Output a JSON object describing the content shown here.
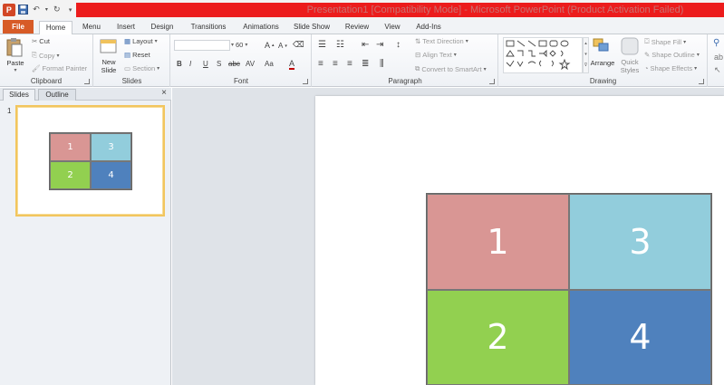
{
  "window": {
    "title": "Presentation1 [Compatibility Mode] - Microsoft PowerPoint (Product Activation Failed)"
  },
  "tabs": [
    {
      "label": "File"
    },
    {
      "label": "Home"
    },
    {
      "label": "Menu"
    },
    {
      "label": "Insert"
    },
    {
      "label": "Design"
    },
    {
      "label": "Transitions"
    },
    {
      "label": "Animations"
    },
    {
      "label": "Slide Show"
    },
    {
      "label": "Review"
    },
    {
      "label": "View"
    },
    {
      "label": "Add-Ins"
    }
  ],
  "ribbon": {
    "clipboard": {
      "label": "Clipboard",
      "paste": "Paste",
      "cut": "Cut",
      "copy": "Copy",
      "format_painter": "Format Painter"
    },
    "slides": {
      "label": "Slides",
      "new_slide": "New Slide",
      "layout": "Layout",
      "reset": "Reset",
      "section": "Section"
    },
    "font": {
      "label": "Font",
      "size": "60",
      "bold": "B",
      "italic": "I",
      "underline": "U",
      "shadow": "S",
      "strike": "abc",
      "spacing": "AV",
      "case": "Aa",
      "color": "A"
    },
    "paragraph": {
      "label": "Paragraph",
      "text_direction": "Text Direction",
      "align_text": "Align Text",
      "convert_smartart": "Convert to SmartArt"
    },
    "drawing": {
      "label": "Drawing",
      "arrange": "Arrange",
      "quick_styles": "Quick Styles",
      "shape_fill": "Shape Fill",
      "shape_outline": "Shape Outline",
      "shape_effects": "Shape Effects"
    }
  },
  "pane": {
    "tab_slides": "Slides",
    "tab_outline": "Outline",
    "close": "×",
    "slide_number": "1"
  },
  "table": {
    "cells": [
      {
        "label": "1",
        "color": "#d99694"
      },
      {
        "label": "3",
        "color": "#92cddc"
      },
      {
        "label": "2",
        "color": "#92d050"
      },
      {
        "label": "4",
        "color": "#4f81bd"
      }
    ]
  },
  "colors": {
    "title_bar": "#ec1c1c",
    "file_tab": "#d75b27",
    "thumb_border": "#f2c55e"
  }
}
